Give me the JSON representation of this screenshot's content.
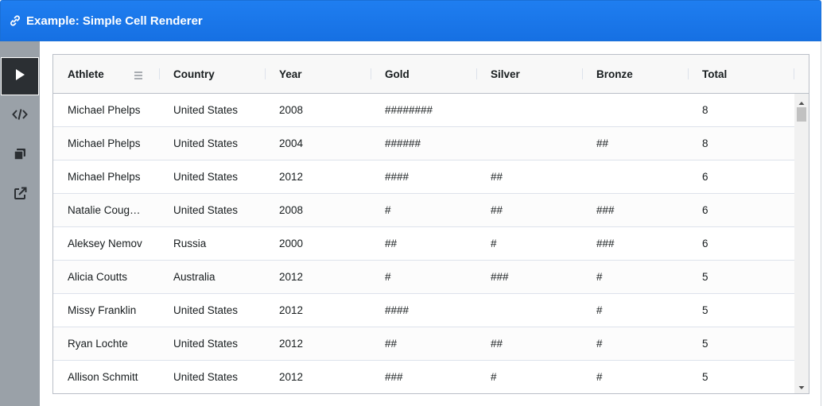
{
  "window": {
    "title": "Example: Simple Cell Renderer"
  },
  "sidebar": {
    "items": [
      {
        "name": "run",
        "icon": "play-icon",
        "active": true
      },
      {
        "name": "code",
        "icon": "code-icon",
        "active": false
      },
      {
        "name": "copy",
        "icon": "copy-icon",
        "active": false
      },
      {
        "name": "open",
        "icon": "external-link-icon",
        "active": false
      }
    ]
  },
  "grid": {
    "columns": [
      "Athlete",
      "Country",
      "Year",
      "Gold",
      "Silver",
      "Bronze",
      "Total"
    ],
    "rows": [
      [
        "Michael Phelps",
        "United States",
        "2008",
        "########",
        "",
        "",
        "8"
      ],
      [
        "Michael Phelps",
        "United States",
        "2004",
        "######",
        "",
        "##",
        "8"
      ],
      [
        "Michael Phelps",
        "United States",
        "2012",
        "####",
        "##",
        "",
        "6"
      ],
      [
        "Natalie Coug…",
        "United States",
        "2008",
        "#",
        "##",
        "###",
        "6"
      ],
      [
        "Aleksey Nemov",
        "Russia",
        "2000",
        "##",
        "#",
        "###",
        "6"
      ],
      [
        "Alicia Coutts",
        "Australia",
        "2012",
        "#",
        "###",
        "#",
        "5"
      ],
      [
        "Missy Franklin",
        "United States",
        "2012",
        "####",
        "",
        "#",
        "5"
      ],
      [
        "Ryan Lochte",
        "United States",
        "2012",
        "##",
        "##",
        "#",
        "5"
      ],
      [
        "Allison Schmitt",
        "United States",
        "2012",
        "###",
        "#",
        "#",
        "5"
      ]
    ]
  },
  "colors": {
    "titlebar": "#1f7ef0",
    "sidebar": "#9aa1a8",
    "sidebar_active": "#2b2f33"
  }
}
